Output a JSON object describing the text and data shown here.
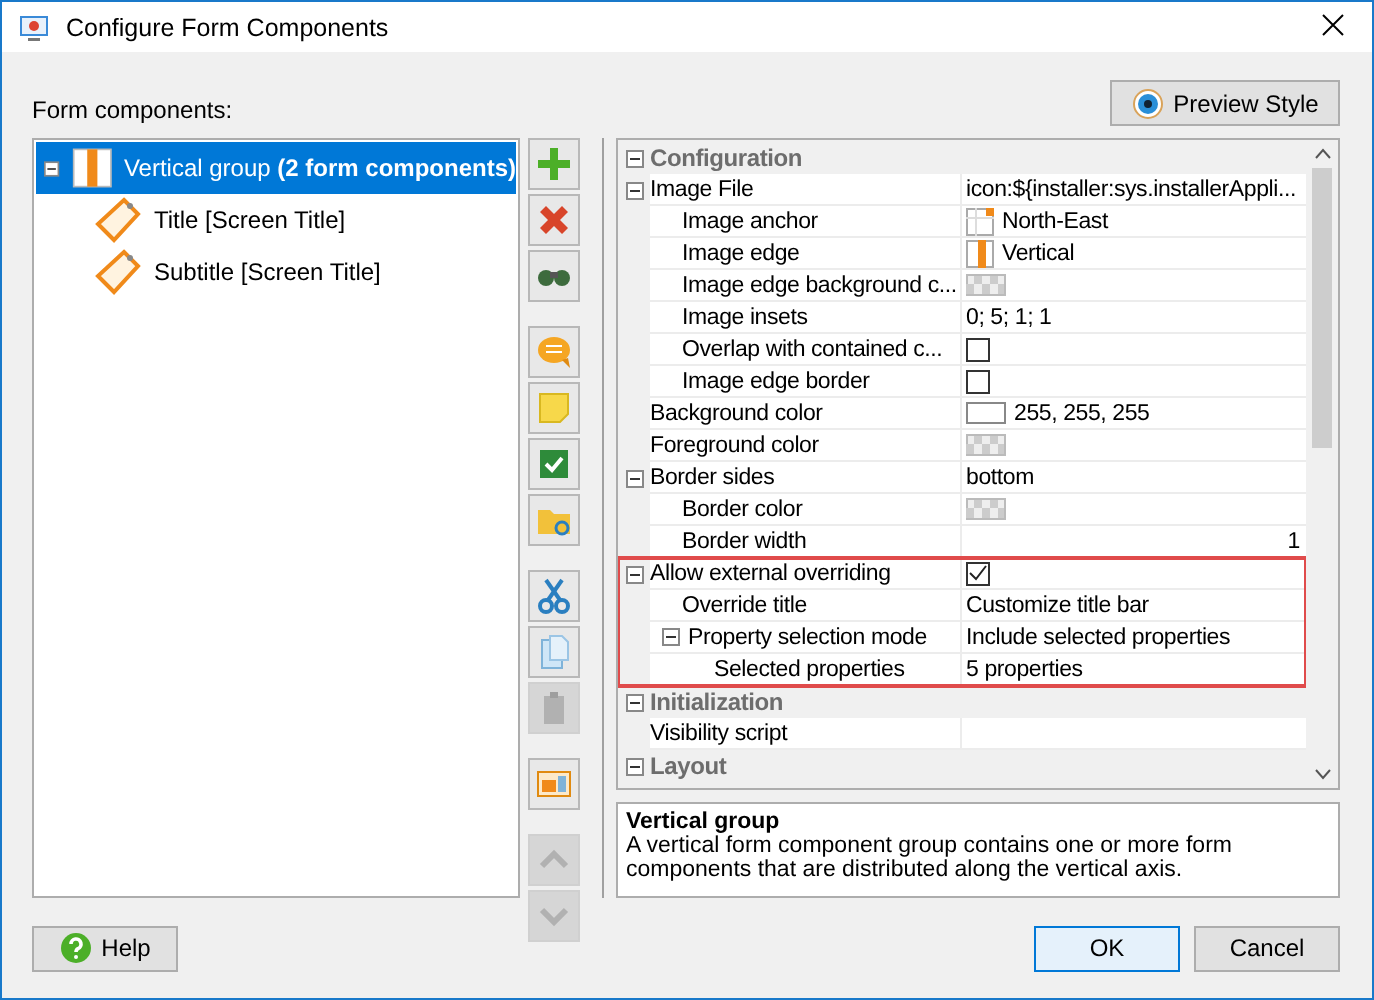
{
  "window": {
    "title": "Configure Form Components"
  },
  "preview_button": "Preview Style",
  "tree_label": "Form components:",
  "tree": [
    {
      "label": "Vertical group **(2 form components)**",
      "kind": "group",
      "selected": true,
      "expanded": true,
      "children": [
        {
          "label": "Title [Screen Title]",
          "kind": "tag",
          "selected": false
        },
        {
          "label": "Subtitle [Screen Title]",
          "kind": "tag",
          "selected": false
        }
      ]
    }
  ],
  "toolbar": [
    [
      {
        "kind": "add",
        "disabled": false
      },
      {
        "kind": "delete",
        "disabled": false
      },
      {
        "kind": "find",
        "disabled": false
      }
    ],
    [
      {
        "kind": "comment",
        "disabled": false
      },
      {
        "kind": "note",
        "disabled": false
      },
      {
        "kind": "check",
        "disabled": false
      },
      {
        "kind": "folder",
        "disabled": false
      }
    ],
    [
      {
        "kind": "cut",
        "disabled": false
      },
      {
        "kind": "copy",
        "disabled": false
      },
      {
        "kind": "paste",
        "disabled": true
      }
    ],
    [
      {
        "kind": "image",
        "disabled": false
      }
    ],
    [
      {
        "kind": "up",
        "disabled": true
      },
      {
        "kind": "down",
        "disabled": true
      }
    ]
  ],
  "properties": [
    {
      "kind": "category",
      "name": "Configuration",
      "expanded": true,
      "children": [
        {
          "kind": "property",
          "name": "Image File",
          "expanded": true,
          "value": {
            "kind": "text",
            "text": "icon:${installer:sys.installerAppli..."
          },
          "children": [
            {
              "kind": "property",
              "name": "Image anchor",
              "value": {
                "kind": "anchor",
                "text": "North-East"
              }
            },
            {
              "kind": "property",
              "name": "Image edge",
              "value": {
                "kind": "edge",
                "text": "Vertical"
              }
            },
            {
              "kind": "property",
              "name": "Image edge background c...",
              "value": {
                "kind": "swatch"
              }
            },
            {
              "kind": "property",
              "name": "Image insets",
              "value": {
                "kind": "text",
                "text": "0; 5; 1; 1"
              }
            },
            {
              "kind": "property",
              "name": "Overlap with contained c...",
              "value": {
                "kind": "checkbox",
                "checked": false
              }
            },
            {
              "kind": "property",
              "name": "Image edge border",
              "value": {
                "kind": "checkbox",
                "checked": false
              }
            }
          ]
        },
        {
          "kind": "property",
          "name": "Background color",
          "value": {
            "kind": "swatch",
            "color": "#ffffff",
            "text": "255, 255, 255"
          }
        },
        {
          "kind": "property",
          "name": "Foreground color",
          "value": {
            "kind": "swatch"
          }
        },
        {
          "kind": "property",
          "name": "Border sides",
          "expanded": true,
          "value": {
            "kind": "text",
            "text": "bottom"
          },
          "children": [
            {
              "kind": "property",
              "name": "Border color",
              "value": {
                "kind": "swatch"
              }
            },
            {
              "kind": "property",
              "name": "Border width",
              "value": {
                "kind": "number",
                "text": "1"
              }
            }
          ]
        },
        {
          "kind": "property",
          "name": "Allow external overriding",
          "expanded": true,
          "highlighted": true,
          "value": {
            "kind": "checkbox",
            "checked": true
          },
          "children": [
            {
              "kind": "property",
              "name": "Override title",
              "value": {
                "kind": "text",
                "text": "Customize title bar"
              }
            },
            {
              "kind": "property",
              "name": "Property selection mode",
              "expanded": true,
              "value": {
                "kind": "text",
                "text": "Include selected properties"
              },
              "children": [
                {
                  "kind": "property",
                  "name": "Selected properties",
                  "value": {
                    "kind": "text",
                    "text": "5 properties"
                  }
                }
              ]
            }
          ]
        }
      ]
    },
    {
      "kind": "category",
      "name": "Initialization",
      "expanded": true,
      "children": [
        {
          "kind": "property",
          "name": "Visibility script"
        }
      ]
    },
    {
      "kind": "category",
      "name": "Layout",
      "expanded": true
    }
  ],
  "description": {
    "title": "Vertical group",
    "text": "A vertical form component group contains one or more form components that are distributed along the vertical axis."
  },
  "buttons": {
    "help": "Help",
    "ok": "OK",
    "cancel": "Cancel"
  }
}
